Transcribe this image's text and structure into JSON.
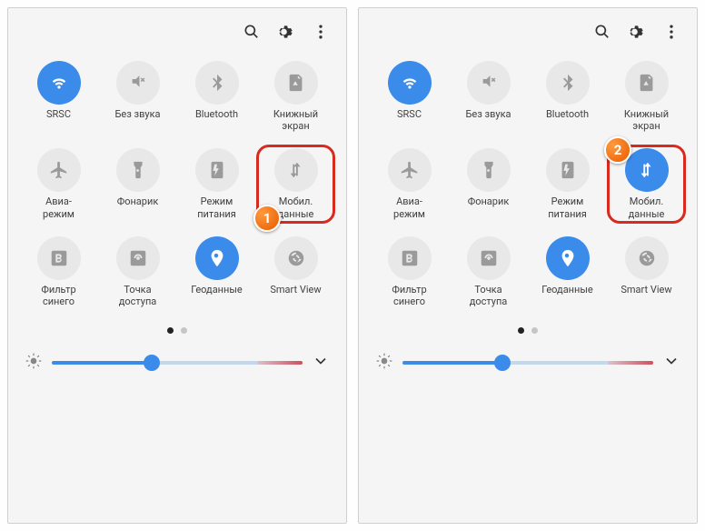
{
  "badges": {
    "left": "1",
    "right": "2"
  },
  "tiles": [
    {
      "key": "wifi",
      "label": "SRSC",
      "active_left": true,
      "active_right": true
    },
    {
      "key": "mute",
      "label": "Без звука",
      "active_left": false,
      "active_right": false
    },
    {
      "key": "bt",
      "label": "Bluetooth",
      "active_left": false,
      "active_right": false
    },
    {
      "key": "book",
      "label": "Книжный\nэкран",
      "active_left": false,
      "active_right": false
    },
    {
      "key": "airplane",
      "label": "Авиа-\nрежим",
      "active_left": false,
      "active_right": false
    },
    {
      "key": "torch",
      "label": "Фонарик",
      "active_left": false,
      "active_right": false
    },
    {
      "key": "power",
      "label": "Режим\nпитания",
      "active_left": false,
      "active_right": false
    },
    {
      "key": "data",
      "label": "Мобил.\nданные",
      "active_left": false,
      "active_right": true,
      "hl": true
    },
    {
      "key": "bluef",
      "label": "Фильтр\nсинего",
      "active_left": false,
      "active_right": false
    },
    {
      "key": "hotspot",
      "label": "Точка\nдоступа",
      "active_left": false,
      "active_right": false
    },
    {
      "key": "geo",
      "label": "Геоданные",
      "active_left": true,
      "active_right": true
    },
    {
      "key": "smart",
      "label": "Smart View",
      "active_left": false,
      "active_right": false
    }
  ],
  "brightness": {
    "percent": 40
  }
}
